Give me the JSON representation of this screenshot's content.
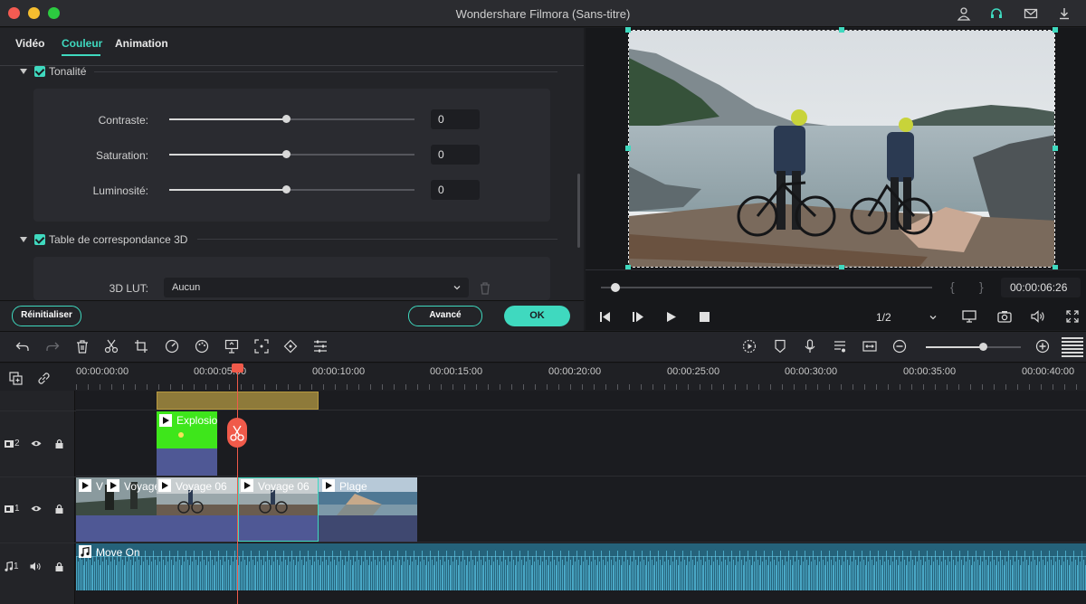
{
  "window": {
    "title": "Wondershare Filmora (Sans-titre)",
    "traffic_colors": [
      "#f45b52",
      "#f5be2f",
      "#2ccb40"
    ]
  },
  "panel": {
    "tabs": [
      {
        "label": "Vidéo"
      },
      {
        "label": "Couleur",
        "active": true
      },
      {
        "label": "Animation"
      }
    ],
    "tone_section": {
      "label": "Tonalité",
      "sliders": [
        {
          "label": "Contraste:",
          "value": "0"
        },
        {
          "label": "Saturation:",
          "value": "0"
        },
        {
          "label": "Luminosité:",
          "value": "0"
        }
      ]
    },
    "lut_section": {
      "label": "Table de correspondance 3D",
      "lut_label": "3D LUT:",
      "lut_value": "Aucun"
    },
    "reset_label": "Réinitialiser",
    "advanced_label": "Avancé",
    "ok_label": "OK"
  },
  "preview": {
    "timecode": "00:00:06:26",
    "ratio": "1/2",
    "bracket_left": "{",
    "bracket_right": "}"
  },
  "timeline": {
    "timecodes": [
      "00:00:00:00",
      "00:00:05:00",
      "00:00:10:00",
      "00:00:15:00",
      "00:00:20:00",
      "00:00:25:00",
      "00:00:30:00",
      "00:00:35:00",
      "00:00:40:00"
    ],
    "tracks": [
      {
        "label": "2"
      },
      {
        "label": "1"
      },
      {
        "label": "1"
      }
    ],
    "clips": {
      "explosion": "Explosio",
      "v": "V",
      "voyage": "Voyage",
      "voyage06a": "Voyage 06",
      "voyage06b": "Voyage 06",
      "plage": "Plage",
      "audio": "Move On"
    }
  },
  "colors": {
    "accent": "#3fd9bf",
    "playhead": "#f05a4a",
    "green_clip": "#3ee61b",
    "audio_clip": "#2e8fa8"
  }
}
